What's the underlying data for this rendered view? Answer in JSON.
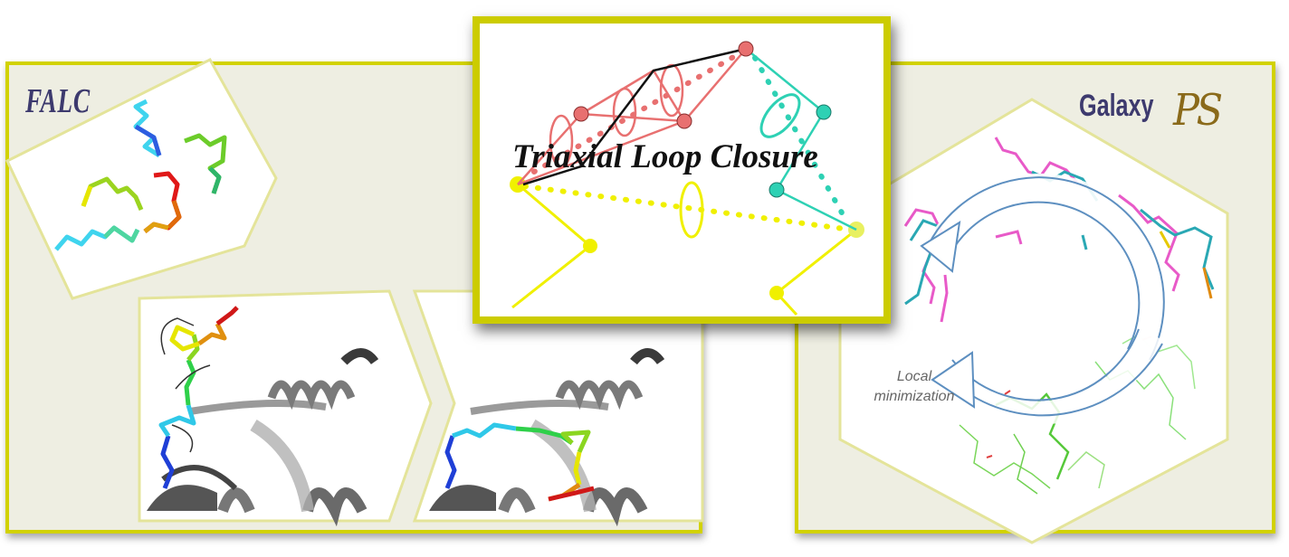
{
  "left_panel": {
    "title": "FALC"
  },
  "center_panel": {
    "title": "Triaxial Loop Closure"
  },
  "right_panel": {
    "title": "Galaxy",
    "logo_text": "PS",
    "label": "Local minimization"
  },
  "colors": {
    "panel_border": "#d2d200",
    "panel_fill": "#eeeee2",
    "title_color": "#3d3a6e",
    "loop_red": "#e86f6f",
    "loop_cyan": "#2ed1b4",
    "loop_yellow": "#f2f200"
  }
}
